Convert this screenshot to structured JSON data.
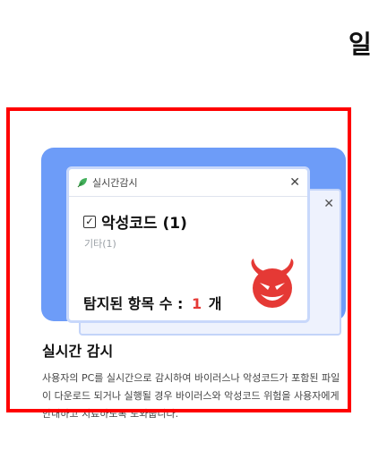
{
  "page": {
    "heading_fragment": "일"
  },
  "feature_card": {
    "illustration": {
      "window_title": "실시간감시",
      "malware_label": "악성코드 (1)",
      "other_label": "기타(1)",
      "detected_label": "탐지된 항목 수 :",
      "detected_count": "1",
      "detected_unit": "개",
      "icons": {
        "leaf": "leaf-icon",
        "close": "close-icon",
        "check": "check-icon",
        "devil": "devil-icon"
      },
      "colors": {
        "background": "#6d9cf8",
        "count": "#e53935",
        "devil": "#e53935"
      }
    },
    "title": "실시간 감시",
    "description": "사용자의 PC를 실시간으로 감시하여 바이러스나 악성코드가 포함된 파일이 다운로드 되거나 실행될 경우 바이러스와 악성코드 위험을 사용자에게 안내하고 치료하도록 도와줍니다."
  },
  "highlight": {
    "color": "#ff0000"
  }
}
